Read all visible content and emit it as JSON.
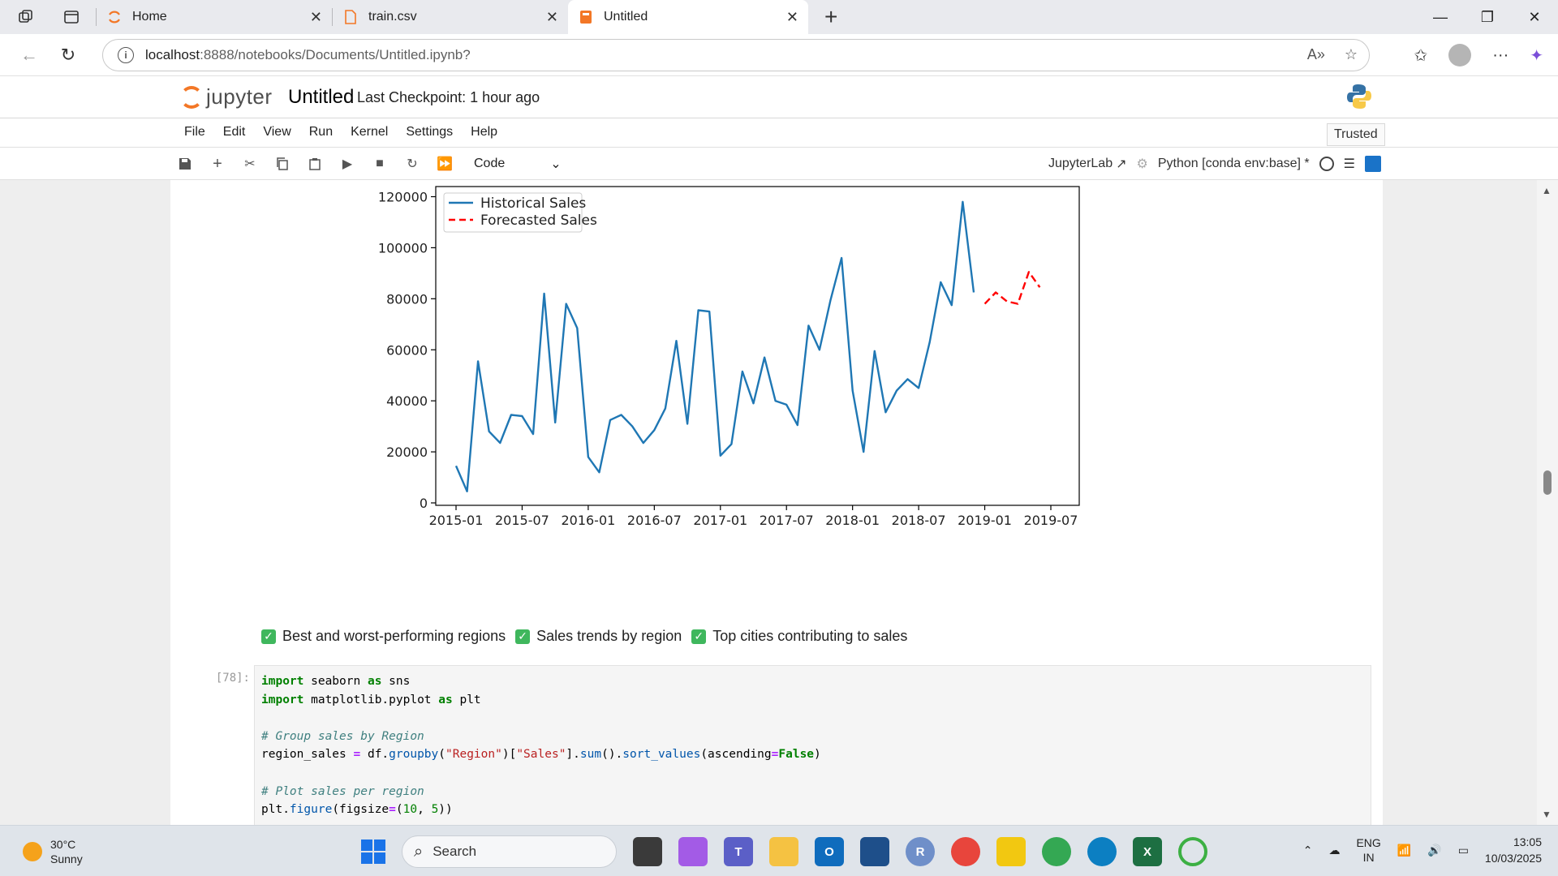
{
  "browser": {
    "tabs": [
      {
        "title": "Home",
        "icon": "jupyter-icon"
      },
      {
        "title": "train.csv",
        "icon": "file-icon"
      },
      {
        "title": "Untitled",
        "icon": "notebook-icon",
        "active": true
      }
    ],
    "url_host": "localhost",
    "url_path": ":8888/notebooks/Documents/Untitled.ipynb?"
  },
  "jupyter": {
    "brand": "jupyter",
    "notebook_title": "Untitled",
    "checkpoint": "Last Checkpoint: 1 hour ago",
    "menu": [
      "File",
      "Edit",
      "View",
      "Run",
      "Kernel",
      "Settings",
      "Help"
    ],
    "trusted": "Trusted",
    "cell_type": "Code",
    "jupyterlab_link": "JupyterLab",
    "kernel": "Python [conda env:base] *"
  },
  "notebook": {
    "checklist": [
      "Best and worst-performing regions",
      "Sales trends by region",
      "Top cities contributing to sales"
    ],
    "cell_prompt": "[78]:",
    "code_lines": [
      "import seaborn as sns",
      "import matplotlib.pyplot as plt",
      "",
      "# Group sales by Region",
      "region_sales = df.groupby(\"Region\")[\"Sales\"].sum().sort_values(ascending=False)",
      "",
      "# Plot sales per region",
      "plt.figure(figsize=(10, 5))"
    ]
  },
  "chart_data": {
    "type": "line",
    "title": "",
    "xlabel": "",
    "ylabel": "",
    "ylim": [
      0,
      125000
    ],
    "y_ticks": [
      0,
      20000,
      40000,
      60000,
      80000,
      100000,
      120000
    ],
    "x_ticks": [
      "2015-01",
      "2015-07",
      "2016-01",
      "2016-07",
      "2017-01",
      "2017-07",
      "2018-01",
      "2018-07",
      "2019-01",
      "2019-07"
    ],
    "legend_position": "top-left",
    "grid": false,
    "series": [
      {
        "name": "Historical Sales",
        "color": "#1f77b4",
        "style": "solid",
        "x": [
          "2015-01",
          "2015-02",
          "2015-03",
          "2015-04",
          "2015-05",
          "2015-06",
          "2015-07",
          "2015-08",
          "2015-09",
          "2015-10",
          "2015-11",
          "2015-12",
          "2016-01",
          "2016-02",
          "2016-03",
          "2016-04",
          "2016-05",
          "2016-06",
          "2016-07",
          "2016-08",
          "2016-09",
          "2016-10",
          "2016-11",
          "2016-12",
          "2017-01",
          "2017-02",
          "2017-03",
          "2017-04",
          "2017-05",
          "2017-06",
          "2017-07",
          "2017-08",
          "2017-09",
          "2017-10",
          "2017-11",
          "2017-12",
          "2018-01",
          "2018-02",
          "2018-03",
          "2018-04",
          "2018-05",
          "2018-06",
          "2018-07",
          "2018-08",
          "2018-09",
          "2018-10",
          "2018-11",
          "2018-12"
        ],
        "values": [
          14500,
          4500,
          55500,
          28000,
          23500,
          34500,
          34000,
          27000,
          82000,
          31500,
          78000,
          68500,
          18000,
          12000,
          32500,
          34500,
          30000,
          23500,
          28500,
          37000,
          63500,
          31000,
          75500,
          75000,
          18500,
          23000,
          51500,
          39000,
          57000,
          40000,
          38500,
          30500,
          69500,
          60000,
          79500,
          96000,
          44000,
          20000,
          59500,
          35500,
          44000,
          48500,
          45000,
          63000,
          86500,
          77500,
          118000,
          82500
        ]
      },
      {
        "name": "Forecasted Sales",
        "color": "#ff0000",
        "style": "dashed",
        "x": [
          "2019-01",
          "2019-02",
          "2019-03",
          "2019-04",
          "2019-05",
          "2019-06"
        ],
        "values": [
          78000,
          82500,
          79000,
          78000,
          90500,
          84500
        ]
      }
    ]
  },
  "taskbar": {
    "temperature": "30°C",
    "weather": "Sunny",
    "search_placeholder": "Search",
    "lang_top": "ENG",
    "lang_bottom": "IN",
    "time": "13:05",
    "date": "10/03/2025"
  },
  "colors": {
    "jupyter_orange": "#f37726",
    "historical_line": "#1f77b4",
    "forecast_line": "#ff0000",
    "check_green": "#3fb75d"
  }
}
